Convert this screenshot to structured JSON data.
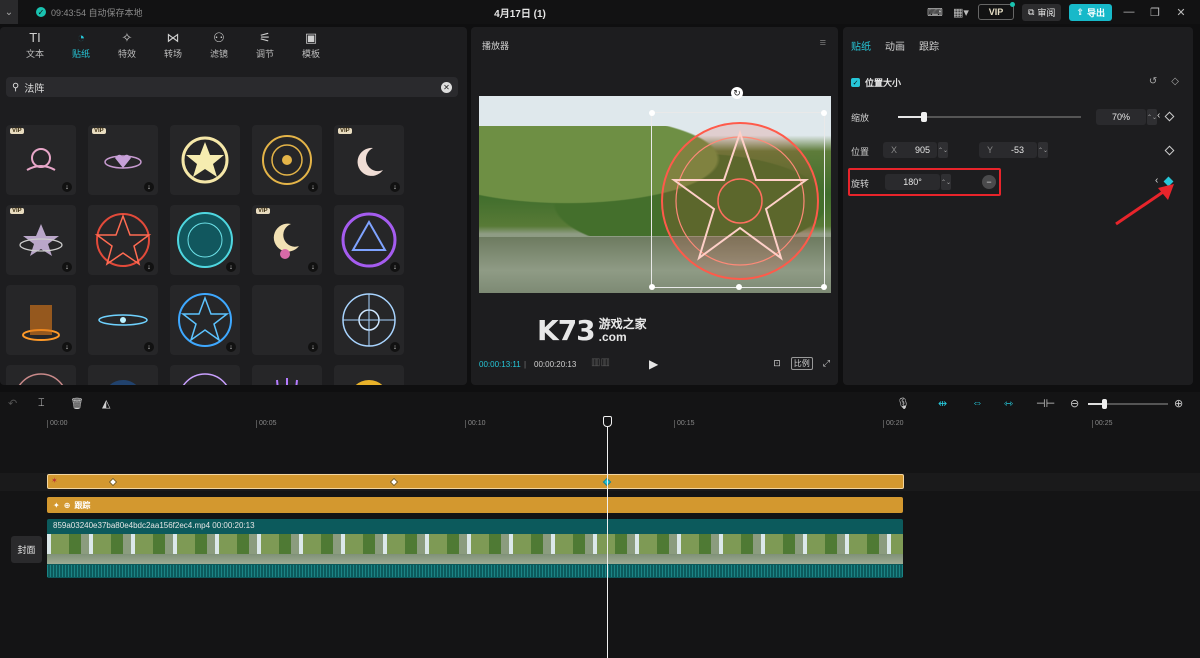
{
  "titlebar": {
    "menu_icon": "chevron-down-icon",
    "save_status": "09:43:54 自动保存本地",
    "project_title": "4月17日 (1)",
    "vip_label": "VIP",
    "review_label": "审阅",
    "export_label": "导出"
  },
  "tool_tabs": [
    {
      "label": "文本",
      "icon": "TI"
    },
    {
      "label": "贴纸",
      "icon": "◔",
      "active": true
    },
    {
      "label": "特效",
      "icon": "✧"
    },
    {
      "label": "转场",
      "icon": "⋈"
    },
    {
      "label": "滤镜",
      "icon": "⚇"
    },
    {
      "label": "调节",
      "icon": "⚟"
    },
    {
      "label": "模板",
      "icon": "▣"
    }
  ],
  "search": {
    "value": "法阵"
  },
  "sticker_vip_label": "VIP",
  "player": {
    "title": "播放器",
    "current_time": "00:00:13:11",
    "separator": "|",
    "total_time": "00:00:20:13",
    "ratio_label": "比例",
    "watermark_main": "K73",
    "watermark_sub1": "游戏之家",
    "watermark_sub2": ".com"
  },
  "inspector": {
    "tabs": [
      {
        "label": "贴纸",
        "active": true
      },
      {
        "label": "动画"
      },
      {
        "label": "跟踪"
      }
    ],
    "section_title": "位置大小",
    "scale_label": "缩放",
    "scale_value": "70%",
    "scale_fraction": 0.14,
    "position_label": "位置",
    "x_label": "X",
    "x_value": "905",
    "y_label": "Y",
    "y_value": "-53",
    "rotate_label": "旋转",
    "rotate_value": "180°"
  },
  "timeline": {
    "ticks": [
      "00:00",
      "00:05",
      "00:10",
      "00:15",
      "00:20",
      "00:25"
    ],
    "effect_clip_label": "跟踪",
    "video_clip_label": "859a03240e37ba80e4bdc2aa156f2ec4.mp4   00:00:20:13",
    "cover_label": "封面"
  },
  "colors": {
    "accent": "#26c6d8",
    "sticker_clip": "#d3982f",
    "video_clip": "#0c5a5c",
    "highlight": "#e8242b"
  }
}
